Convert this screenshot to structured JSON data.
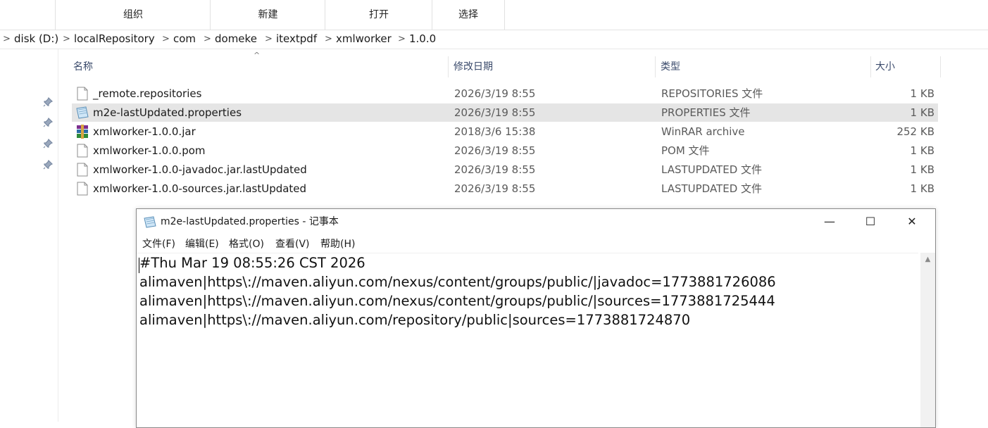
{
  "ribbon": {
    "tabs": [
      "组织",
      "新建",
      "打开",
      "选择"
    ]
  },
  "address": {
    "segments": [
      "disk (D:)",
      "localRepository",
      "com",
      "domeke",
      "itextpdf",
      "xmlworker",
      "1.0.0"
    ],
    "separator": ">"
  },
  "columns": {
    "name": "名称",
    "date": "修改日期",
    "type": "类型",
    "size": "大小",
    "sort_caret": "^"
  },
  "files": [
    {
      "name": "_remote.repositories",
      "date": "2026/3/19 8:55",
      "type": "REPOSITORIES 文件",
      "size": "1 KB",
      "icon": "blank-file-icon",
      "selected": false
    },
    {
      "name": "m2e-lastUpdated.properties",
      "date": "2026/3/19 8:55",
      "type": "PROPERTIES 文件",
      "size": "1 KB",
      "icon": "notepad-file-icon",
      "selected": true
    },
    {
      "name": "xmlworker-1.0.0.jar",
      "date": "2018/3/6 15:38",
      "type": "WinRAR archive",
      "size": "252 KB",
      "icon": "winrar-icon",
      "selected": false
    },
    {
      "name": "xmlworker-1.0.0.pom",
      "date": "2026/3/19 8:55",
      "type": "POM 文件",
      "size": "1 KB",
      "icon": "blank-file-icon",
      "selected": false
    },
    {
      "name": "xmlworker-1.0.0-javadoc.jar.lastUpdated",
      "date": "2026/3/19 8:55",
      "type": "LASTUPDATED 文件",
      "size": "1 KB",
      "icon": "blank-file-icon",
      "selected": false
    },
    {
      "name": "xmlworker-1.0.0-sources.jar.lastUpdated",
      "date": "2026/3/19 8:55",
      "type": "LASTUPDATED 文件",
      "size": "1 KB",
      "icon": "blank-file-icon",
      "selected": false
    }
  ],
  "notepad": {
    "title": "m2e-lastUpdated.properties - 记事本",
    "menu": [
      "文件(F)",
      "编辑(E)",
      "格式(O)",
      "查看(V)",
      "帮助(H)"
    ],
    "buttons": {
      "minimize": "—",
      "maximize": "☐",
      "close": "✕"
    },
    "lines": [
      "#Thu Mar 19 08:55:26 CST 2026",
      "alimaven|https\\://maven.aliyun.com/nexus/content/groups/public/|javadoc=1773881726086",
      "alimaven|https\\://maven.aliyun.com/nexus/content/groups/public/|sources=1773881725444",
      "alimaven|https\\://maven.aliyun.com/repository/public|sources=1773881724870"
    ]
  },
  "colors": {
    "selected_row": "#e5e5e5",
    "header_text": "#3a4a6b"
  }
}
